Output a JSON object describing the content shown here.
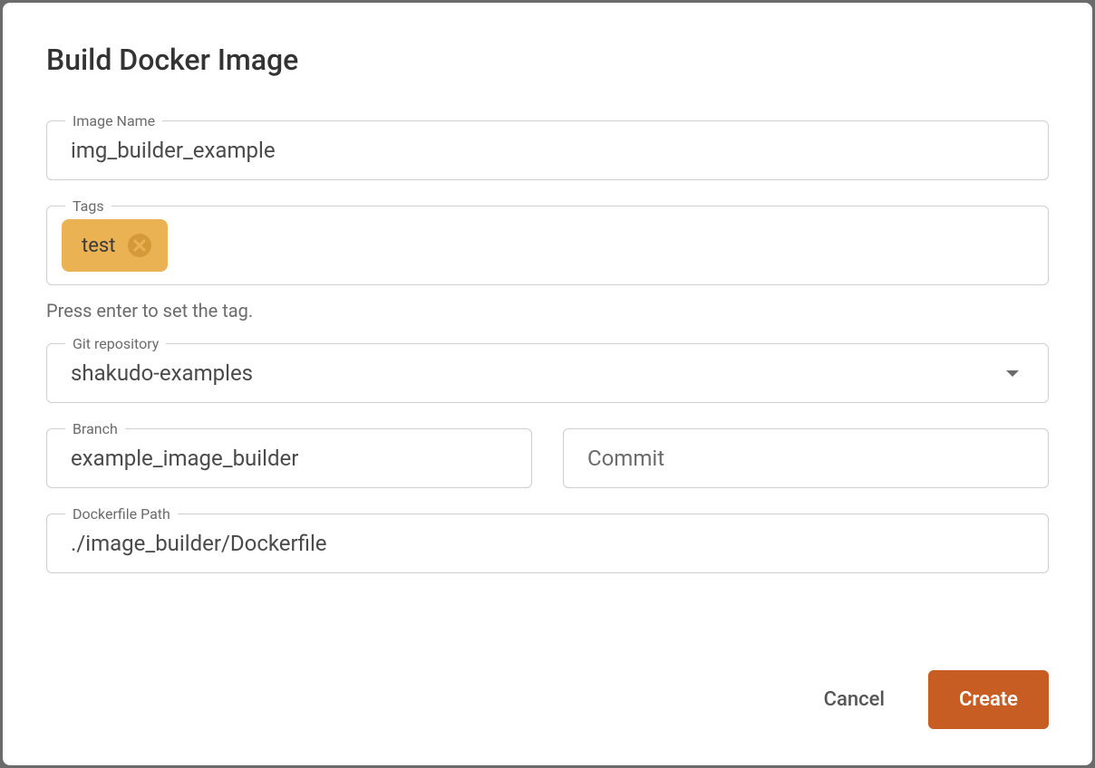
{
  "dialog": {
    "title": "Build Docker Image"
  },
  "fields": {
    "imageName": {
      "label": "Image Name",
      "value": "img_builder_example"
    },
    "tags": {
      "label": "Tags",
      "chips": [
        {
          "label": "test"
        }
      ],
      "helper": "Press enter to set the tag."
    },
    "gitRepo": {
      "label": "Git repository",
      "value": "shakudo-examples"
    },
    "branch": {
      "label": "Branch",
      "value": "example_image_builder"
    },
    "commit": {
      "placeholder": "Commit",
      "value": ""
    },
    "dockerfilePath": {
      "label": "Dockerfile Path",
      "value": "./image_builder/Dockerfile"
    }
  },
  "actions": {
    "cancel": "Cancel",
    "create": "Create"
  }
}
